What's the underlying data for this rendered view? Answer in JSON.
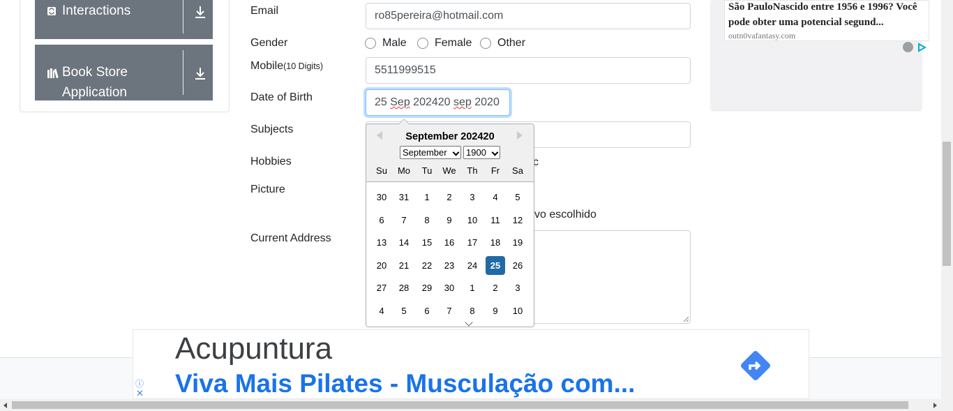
{
  "sidebar": {
    "groups": [
      {
        "label": "Interactions",
        "icon": "interactions-icon"
      },
      {
        "label": "Book Store",
        "label2": "Application",
        "icon": "books-icon"
      }
    ]
  },
  "form": {
    "email": {
      "label": "Email",
      "value": "ro85pereira@hotmail.com"
    },
    "gender": {
      "label": "Gender",
      "options": [
        "Male",
        "Female",
        "Other"
      ]
    },
    "mobile": {
      "label": "Mobile",
      "hint": "(10 Digits)",
      "value": "5511999515"
    },
    "dob": {
      "label": "Date of Birth",
      "value_a": "25 ",
      "value_b": "Sep",
      "value_c": " ",
      "value_d": "202420",
      "value_e": " ",
      "value_f": "sep",
      "value_g": " 2020"
    },
    "subjects": {
      "label": "Subjects"
    },
    "hobbies": {
      "label": "Hobbies",
      "clipped": "c"
    },
    "picture": {
      "label": "Picture",
      "file_status": "vo escolhido"
    },
    "address": {
      "label": "Current Address"
    }
  },
  "datepicker": {
    "title": "September 202420",
    "month_select": "September",
    "year_select": "1900",
    "day_names": [
      "Su",
      "Mo",
      "Tu",
      "We",
      "Th",
      "Fr",
      "Sa"
    ],
    "weeks": [
      [
        "30",
        "31",
        "1",
        "2",
        "3",
        "4",
        "5"
      ],
      [
        "6",
        "7",
        "8",
        "9",
        "10",
        "11",
        "12"
      ],
      [
        "13",
        "14",
        "15",
        "16",
        "17",
        "18",
        "19"
      ],
      [
        "20",
        "21",
        "22",
        "23",
        "24",
        "25",
        "26"
      ],
      [
        "27",
        "28",
        "29",
        "30",
        "1",
        "2",
        "3"
      ],
      [
        "4",
        "5",
        "6",
        "7",
        "8",
        "9",
        "10"
      ]
    ],
    "selected_day": "25",
    "selected_color": "#216ba5"
  },
  "ad_top": {
    "text": "São PauloNascido entre 1956 e 1996? Você pode obter uma potencial segund...",
    "domain": "outn0vafantasy.com"
  },
  "ad_bottom": {
    "title": "Acupuntura",
    "subtitle": "Viva Mais Pilates - Musculação com...",
    "accent": "#1a73e8"
  }
}
